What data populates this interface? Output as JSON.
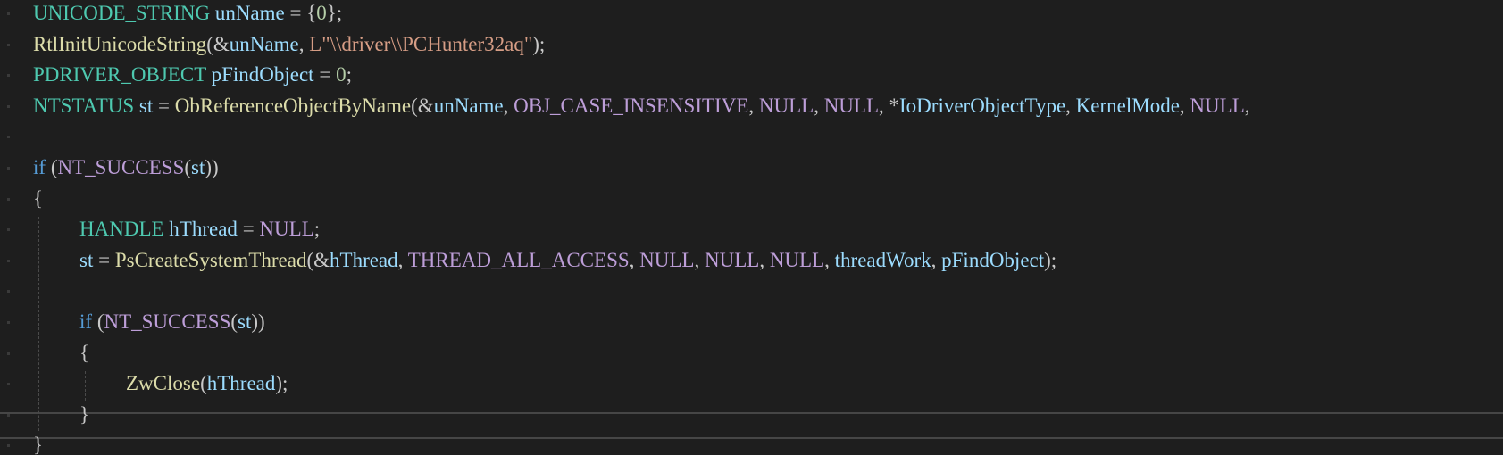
{
  "editor": {
    "lines": [
      {
        "indent": 0,
        "tokens": [
          {
            "t": "UNICODE_STRING",
            "c": "type"
          },
          {
            "t": " ",
            "c": "punc"
          },
          {
            "t": "unName",
            "c": "var"
          },
          {
            "t": " = {",
            "c": "punc"
          },
          {
            "t": "0",
            "c": "num"
          },
          {
            "t": "};",
            "c": "punc"
          }
        ]
      },
      {
        "indent": 0,
        "tokens": [
          {
            "t": "RtlInitUnicodeString",
            "c": "fn"
          },
          {
            "t": "(&",
            "c": "punc"
          },
          {
            "t": "unName",
            "c": "var"
          },
          {
            "t": ", ",
            "c": "punc"
          },
          {
            "t": "L\"\\\\driver\\\\PCHunter32aq\"",
            "c": "str"
          },
          {
            "t": ");",
            "c": "punc"
          }
        ]
      },
      {
        "indent": 0,
        "tokens": [
          {
            "t": "PDRIVER_OBJECT",
            "c": "type"
          },
          {
            "t": " ",
            "c": "punc"
          },
          {
            "t": "pFindObject",
            "c": "var"
          },
          {
            "t": " = ",
            "c": "punc"
          },
          {
            "t": "0",
            "c": "num"
          },
          {
            "t": ";",
            "c": "punc"
          }
        ]
      },
      {
        "indent": 0,
        "tokens": [
          {
            "t": "NTSTATUS",
            "c": "type"
          },
          {
            "t": " ",
            "c": "punc"
          },
          {
            "t": "st",
            "c": "var"
          },
          {
            "t": " = ",
            "c": "punc"
          },
          {
            "t": "ObReferenceObjectByName",
            "c": "fn"
          },
          {
            "t": "(&",
            "c": "punc"
          },
          {
            "t": "unName",
            "c": "var"
          },
          {
            "t": ", ",
            "c": "punc"
          },
          {
            "t": "OBJ_CASE_INSENSITIVE",
            "c": "macro"
          },
          {
            "t": ", ",
            "c": "punc"
          },
          {
            "t": "NULL",
            "c": "macro"
          },
          {
            "t": ", ",
            "c": "punc"
          },
          {
            "t": "NULL",
            "c": "macro"
          },
          {
            "t": ", *",
            "c": "punc"
          },
          {
            "t": "IoDriverObjectType",
            "c": "var"
          },
          {
            "t": ", ",
            "c": "punc"
          },
          {
            "t": "KernelMode",
            "c": "var"
          },
          {
            "t": ", ",
            "c": "punc"
          },
          {
            "t": "NULL",
            "c": "macro"
          },
          {
            "t": ",",
            "c": "punc"
          }
        ]
      },
      {
        "indent": 0,
        "tokens": []
      },
      {
        "indent": 0,
        "tokens": [
          {
            "t": "if",
            "c": "kw"
          },
          {
            "t": " (",
            "c": "punc"
          },
          {
            "t": "NT_SUCCESS",
            "c": "macro"
          },
          {
            "t": "(",
            "c": "punc"
          },
          {
            "t": "st",
            "c": "var"
          },
          {
            "t": "))",
            "c": "punc"
          }
        ]
      },
      {
        "indent": 0,
        "tokens": [
          {
            "t": "{",
            "c": "punc"
          }
        ]
      },
      {
        "indent": 1,
        "tokens": [
          {
            "t": "HANDLE",
            "c": "type"
          },
          {
            "t": " ",
            "c": "punc"
          },
          {
            "t": "hThread",
            "c": "var"
          },
          {
            "t": " = ",
            "c": "punc"
          },
          {
            "t": "NULL",
            "c": "macro"
          },
          {
            "t": ";",
            "c": "punc"
          }
        ]
      },
      {
        "indent": 1,
        "tokens": [
          {
            "t": "st",
            "c": "var"
          },
          {
            "t": " = ",
            "c": "punc"
          },
          {
            "t": "PsCreateSystemThread",
            "c": "fn"
          },
          {
            "t": "(&",
            "c": "punc"
          },
          {
            "t": "hThread",
            "c": "var"
          },
          {
            "t": ", ",
            "c": "punc"
          },
          {
            "t": "THREAD_ALL_ACCESS",
            "c": "macro"
          },
          {
            "t": ", ",
            "c": "punc"
          },
          {
            "t": "NULL",
            "c": "macro"
          },
          {
            "t": ", ",
            "c": "punc"
          },
          {
            "t": "NULL",
            "c": "macro"
          },
          {
            "t": ", ",
            "c": "punc"
          },
          {
            "t": "NULL",
            "c": "macro"
          },
          {
            "t": ", ",
            "c": "punc"
          },
          {
            "t": "threadWork",
            "c": "var"
          },
          {
            "t": ", ",
            "c": "punc"
          },
          {
            "t": "pFindObject",
            "c": "var"
          },
          {
            "t": ");",
            "c": "punc"
          }
        ]
      },
      {
        "indent": 1,
        "tokens": []
      },
      {
        "indent": 1,
        "tokens": [
          {
            "t": "if",
            "c": "kw"
          },
          {
            "t": " (",
            "c": "punc"
          },
          {
            "t": "NT_SUCCESS",
            "c": "macro"
          },
          {
            "t": "(",
            "c": "punc"
          },
          {
            "t": "st",
            "c": "var"
          },
          {
            "t": "))",
            "c": "punc"
          }
        ]
      },
      {
        "indent": 1,
        "tokens": [
          {
            "t": "{",
            "c": "punc"
          }
        ]
      },
      {
        "indent": 2,
        "tokens": [
          {
            "t": "ZwClose",
            "c": "fn"
          },
          {
            "t": "(",
            "c": "punc"
          },
          {
            "t": "hThread",
            "c": "var"
          },
          {
            "t": ");",
            "c": "punc"
          }
        ]
      },
      {
        "indent": 1,
        "tokens": [
          {
            "t": "}",
            "c": "punc"
          }
        ]
      },
      {
        "indent": 0,
        "tokens": [
          {
            "t": "}",
            "c": "punc"
          }
        ]
      }
    ],
    "current_line_index": 13,
    "colors": {
      "background": "#1e1e1e",
      "type": "#4ec9b0",
      "variable": "#9cdcfe",
      "function": "#dcdcaa",
      "keyword": "#569cd6",
      "string": "#d69d85",
      "number": "#b5cea8",
      "macro": "#bd9ed8"
    }
  }
}
